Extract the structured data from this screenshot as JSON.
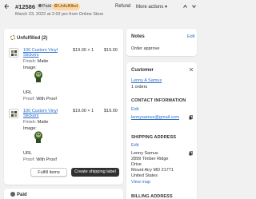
{
  "header": {
    "order_number": "#12586",
    "paid_badge": "Paid",
    "unfulfilled_badge": "Unfulfilled",
    "meta": "March 23, 2022 at 2:02 pm from Online Store",
    "refund_label": "Refund",
    "more_actions_label": "More actions"
  },
  "unfulfilled": {
    "heading": "Unfulfilled (2)",
    "items": [
      {
        "title": "100 Custom Vinyl Stickers",
        "price": "$19.00 × 1",
        "total": "$19.00",
        "finish_label": "Finish:",
        "finish_value": "Matte",
        "image_label": "Image:",
        "url_label": "URL",
        "proof_label": "Proof:",
        "proof_value": "With Proof"
      },
      {
        "title": "100 Custom Vinyl Stickers",
        "price": "$19.00 × 1",
        "total": "$19.00",
        "finish_label": "Finish:",
        "finish_value": "Matte",
        "image_label": "Image:",
        "url_label": "URL",
        "proof_label": "Proof:",
        "proof_value": "With Proof"
      }
    ],
    "fulfill_label": "Fulfill items",
    "ship_label": "Create shipping label"
  },
  "paid_section": {
    "heading": "Paid"
  },
  "notes": {
    "title": "Notes",
    "edit": "Edit",
    "text": "Order approve"
  },
  "customer": {
    "title": "Customer",
    "name": "Lenny A Samus",
    "orders": "1 orders",
    "contact_title": "CONTACT INFORMATION",
    "contact_edit": "Edit",
    "email": "lennysamus@gmail.com",
    "shipping_title": "SHIPPING ADDRESS",
    "shipping_edit": "Edit",
    "address_lines": [
      "Lenny Samus",
      "2899 Timber Ridge",
      "Drive",
      "Mount Airy MD 21771",
      "United States"
    ],
    "view_map": "View map",
    "billing_title": "BILLING ADDRESS"
  },
  "colors": {
    "accent_link": "#2c6ecb",
    "primary_button": "#303030",
    "unfulfilled_badge_bg": "#ffd6a4",
    "paid_badge_bg": "#e3e3e3",
    "page_bg": "#f1f1f1"
  },
  "icons": [
    "back-arrow-icon",
    "chevron-down-icon",
    "chevron-up-icon",
    "close-icon",
    "copy-icon",
    "unfulfilled-status-icon",
    "paid-status-icon"
  ]
}
